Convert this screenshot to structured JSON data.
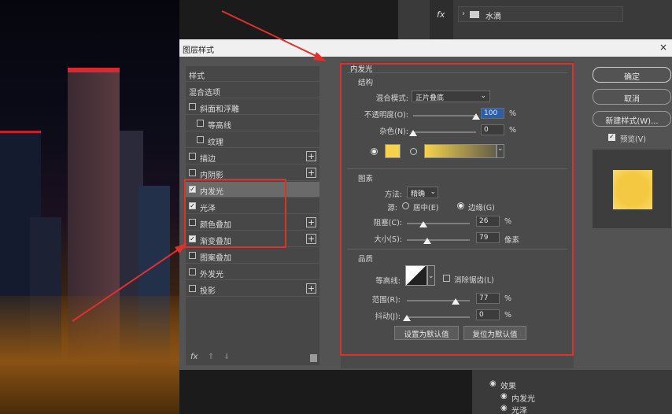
{
  "right_panel": {
    "fx": "fx",
    "layer_name": "水滴",
    "effects": "效果",
    "effect_inner_glow": "内发光",
    "effect_gloss": "光泽",
    "icon_folder": "folder-icon"
  },
  "dialog": {
    "title": "图层样式",
    "close": "×",
    "styles_header": "样式",
    "blend_options": "混合选项",
    "items": [
      {
        "label": "斜面和浮雕",
        "checked": false,
        "plus": false
      },
      {
        "label": "等高线",
        "checked": false,
        "plus": false
      },
      {
        "label": "纹理",
        "checked": false,
        "plus": false
      },
      {
        "label": "描边",
        "checked": false,
        "plus": true
      },
      {
        "label": "内阴影",
        "checked": false,
        "plus": true
      },
      {
        "label": "内发光",
        "checked": true,
        "plus": false
      },
      {
        "label": "光泽",
        "checked": true,
        "plus": false
      },
      {
        "label": "颜色叠加",
        "checked": false,
        "plus": true
      },
      {
        "label": "渐变叠加",
        "checked": true,
        "plus": true
      },
      {
        "label": "图案叠加",
        "checked": false,
        "plus": false
      },
      {
        "label": "外发光",
        "checked": false,
        "plus": false
      },
      {
        "label": "投影",
        "checked": false,
        "plus": true
      }
    ],
    "fx_label": "fx",
    "panel_title": "内发光",
    "structure": {
      "title": "结构",
      "blend_label": "混合模式:",
      "blend_value": "正片叠底",
      "opacity_label": "不透明度(O):",
      "opacity_value": "100",
      "opacity_pct": 100,
      "noise_label": "杂色(N):",
      "noise_value": "0",
      "noise_pct": 0,
      "pct": "%",
      "glow_color": "#f5d24c"
    },
    "elements": {
      "title": "图素",
      "method_label": "方法:",
      "method_value": "精确",
      "source_label": "源:",
      "source_center": "居中(E)",
      "source_edge": "边缘(G)",
      "choke_label": "阻塞(C):",
      "choke_value": "26",
      "choke_pct": 26,
      "size_label": "大小(S):",
      "size_value": "79",
      "size_unit": "像素",
      "size_pct": 32
    },
    "quality": {
      "title": "品质",
      "contour_label": "等高线:",
      "antialias_label": "消除锯齿(L)",
      "range_label": "范围(R):",
      "range_value": "77",
      "range_pct": 77,
      "jitter_label": "抖动(J):",
      "jitter_value": "0",
      "jitter_pct": 0
    },
    "btn_set_default": "设置为默认值",
    "btn_reset_default": "复位为默认值",
    "btn_ok": "确定",
    "btn_cancel": "取消",
    "btn_new_style": "新建样式(W)...",
    "preview_label": "预览(V)",
    "preview_color": "#f5c842"
  }
}
